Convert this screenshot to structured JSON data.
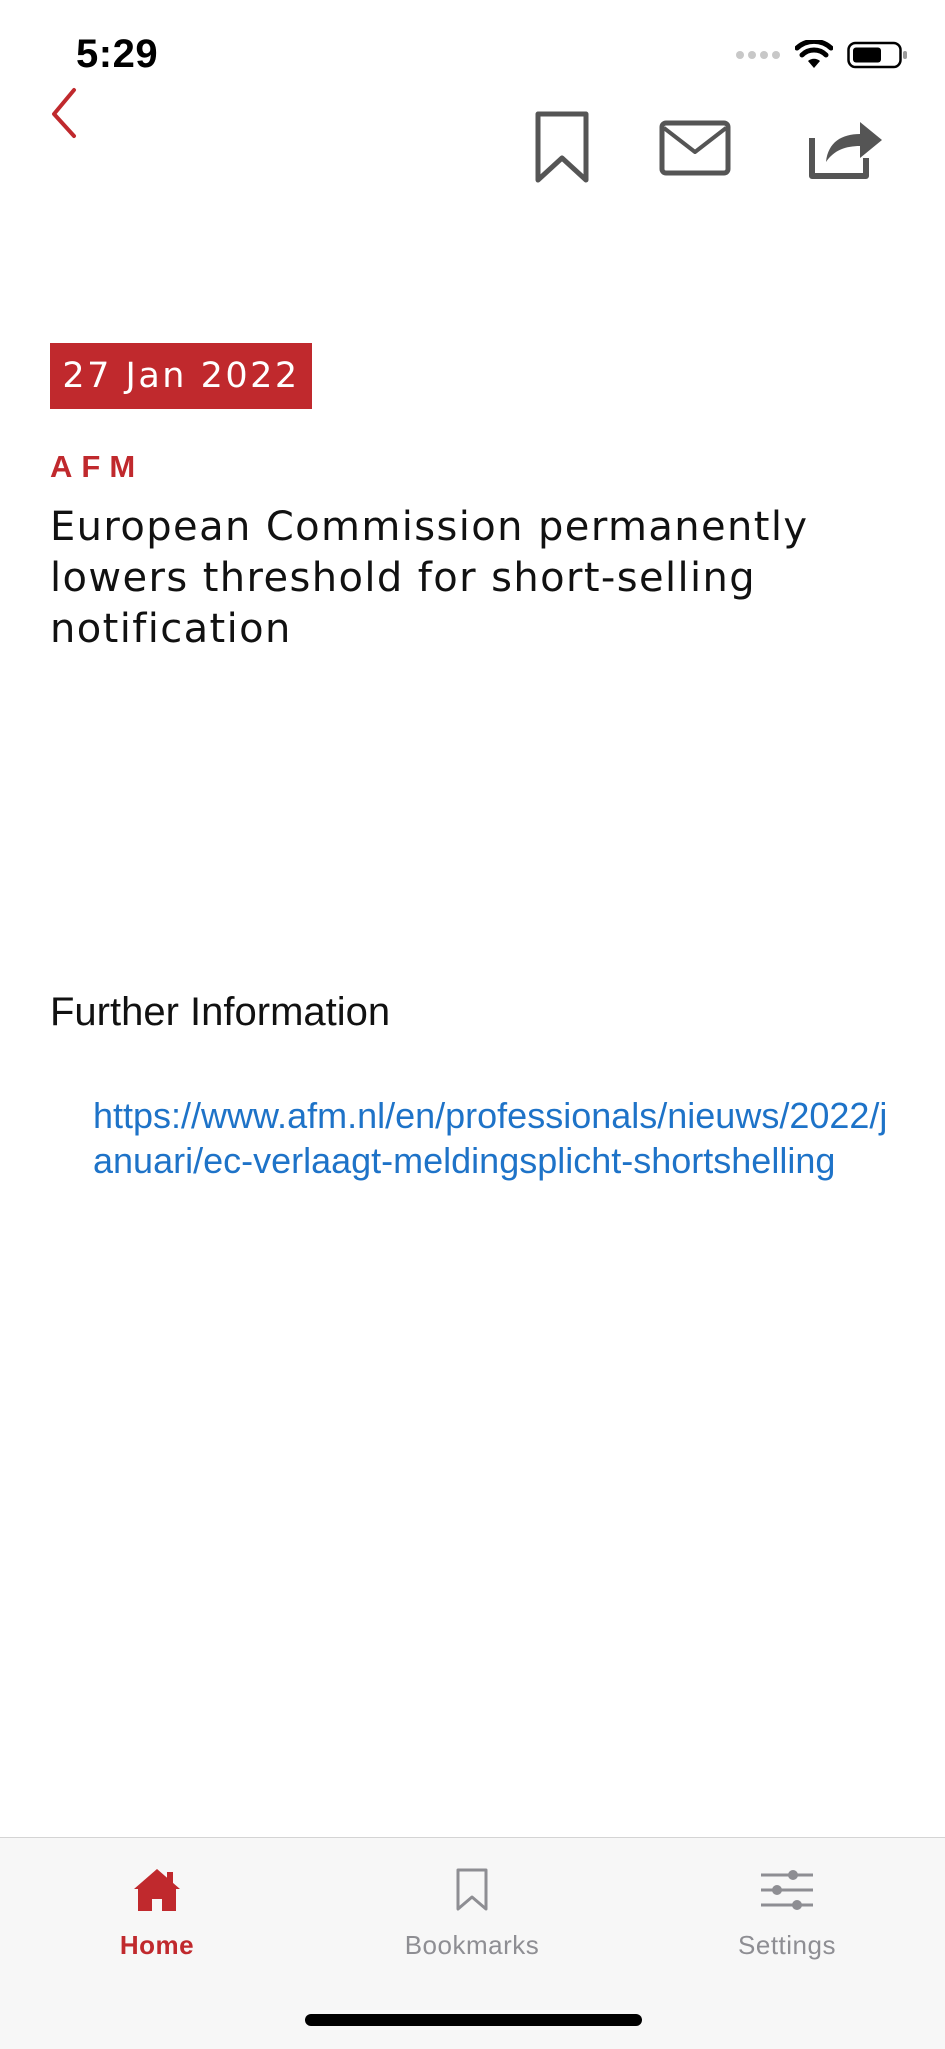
{
  "status_bar": {
    "time": "5:29"
  },
  "article": {
    "date": "27 Jan 2022",
    "source": "AFM",
    "headline": "European Commission permanently lowers threshold for short-selling notification"
  },
  "further_info": {
    "title": "Further Information",
    "link": "https://www.afm.nl/en/professionals/nieuws/2022/januari/ec-verlaagt-meldingsplicht-shortshelling"
  },
  "tab_bar": {
    "items": [
      {
        "label": "Home",
        "icon": "home-icon",
        "active": true
      },
      {
        "label": "Bookmarks",
        "icon": "bookmark-icon",
        "active": false
      },
      {
        "label": "Settings",
        "icon": "sliders-icon",
        "active": false
      }
    ]
  },
  "colors": {
    "accent": "#c0292d",
    "link": "#1e73c8",
    "inactive": "#8e8e93"
  }
}
